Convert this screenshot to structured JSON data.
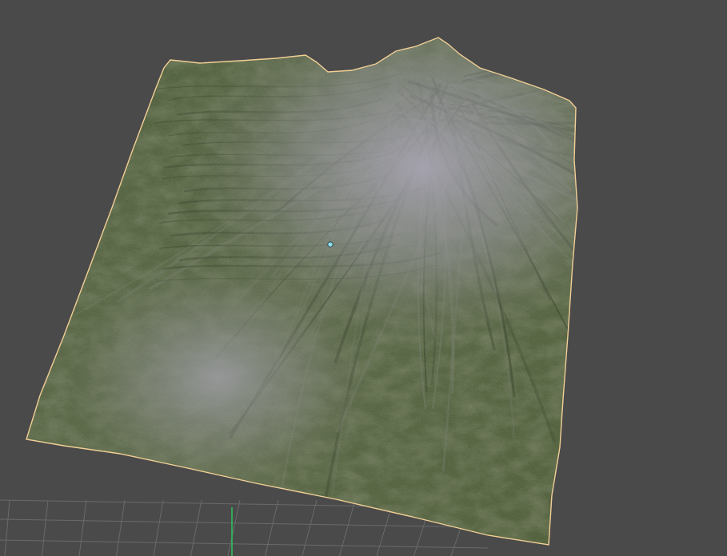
{
  "viewport": {
    "background_color": "#4a4a4a",
    "grid_color": "#6a6a6a",
    "axis_color": "#2fc45a"
  },
  "terrain": {
    "base_color": "#4c5b35",
    "highlight_color": "#9e9cab",
    "selection_outline_color": "#f2cf96",
    "selected": true
  },
  "marker": {
    "icon": "cursor-point-icon",
    "color": "#8fdced"
  }
}
